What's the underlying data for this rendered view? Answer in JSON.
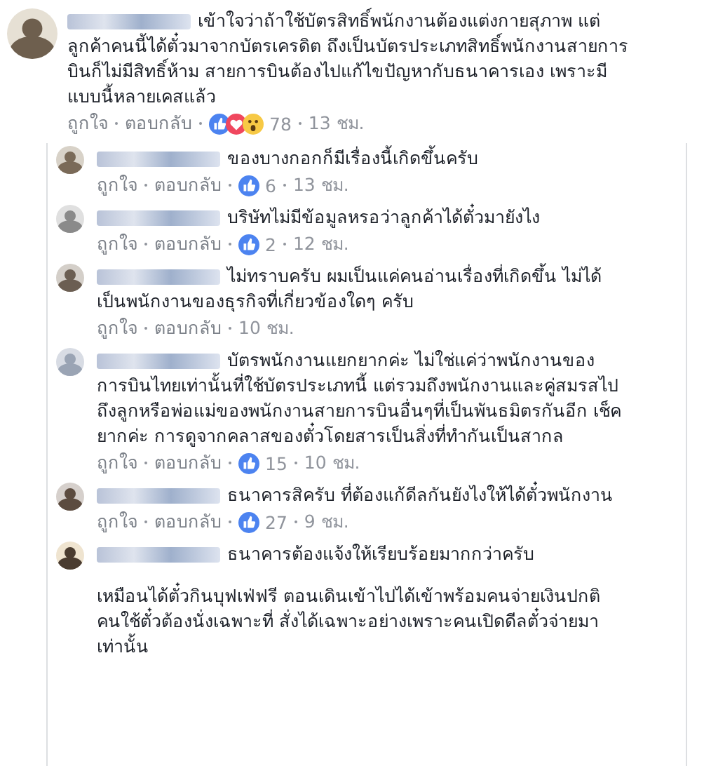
{
  "comment": {
    "text": "เข้าใจว่าถ้าใช้บัตรสิทธิ์พนักงานต้องแต่งกายสุภาพ แต่ลูกค้าคนนี้ได้ตั๋วมาจากบัตรเครดิต ถึงเป็นบัตรประเภทสิทธิ์พนักงานสายการบินก็ไม่มีสิทธิ์ห้าม สายการบินต้องไปแก้ไขปัญหากับธนาคารเอง เพราะมีแบบนี้หลายเคสแล้ว",
    "like": "ถูกใจ",
    "reply": "ตอบกลับ",
    "reactions": [
      {
        "kind": "like"
      },
      {
        "kind": "love"
      },
      {
        "kind": "wow"
      }
    ],
    "count": "78",
    "time": "13 ชม.",
    "replies": [
      {
        "text": "ของบางกอกก็มีเรื่องนี้เกิดขึ้นครับ",
        "like": "ถูกใจ",
        "reply": "ตอบกลับ",
        "reactions": [
          {
            "kind": "like"
          }
        ],
        "count": "6",
        "time": "13 ชม."
      },
      {
        "text": "บริษัทไม่มีข้อมูลหรอว่าลูกค้าได้ตั๋วมายังไง",
        "like": "ถูกใจ",
        "reply": "ตอบกลับ",
        "reactions": [
          {
            "kind": "like"
          }
        ],
        "count": "2",
        "time": "12 ชม."
      },
      {
        "text": "ไม่ทราบครับ ผมเป็นแค่คนอ่านเรื่องที่เกิดขึ้น ไม่ได้เป็นพนักงานของธุรกิจที่เกี่ยวข้องใดๆ ครับ",
        "like": "ถูกใจ",
        "reply": "ตอบกลับ",
        "time": "10 ชม."
      },
      {
        "text": "บัตรพนักงานแยกยากค่ะ ไม่ใช่แค่ว่าพนักงานของการบินไทยเท่านั้นที่ใช้บัตรประเภทนี้ แต่รวมถึงพนักงานและคู่สมรสไปถึงลูกหรือพ่อแม่ของพนักงานสายการบินอื่นๆที่เป็นพันธมิตรกันอีก เช็คยากค่ะ การดูจากคลาสของตั๋วโดยสารเป็นสิ่งที่ทำกันเป็นสากล",
        "like": "ถูกใจ",
        "reply": "ตอบกลับ",
        "reactions": [
          {
            "kind": "like"
          }
        ],
        "count": "15",
        "time": "10 ชม."
      },
      {
        "text": "ธนาคารสิครับ ที่ต้องแก้ดีลกันยังไงให้ได้ตั๋วพนักงาน",
        "like": "ถูกใจ",
        "reply": "ตอบกลับ",
        "reactions": [
          {
            "kind": "like"
          }
        ],
        "count": "27",
        "time": "9 ชม."
      },
      {
        "text": "ธนาคารต้องแจ้งให้เรียบร้อยมากกว่าครับ",
        "extra": "เหมือนได้ตั๋วกินบุฟเฟ่ฟรี ตอนเดินเข้าไปได้เข้าพร้อมคนจ่ายเงินปกติ คนใช้ตั๋วต้องนั่งเฉพาะที่ สั่งได้เฉพาะอย่างเพราะคนเปิดดีลตั๋วจ่ายมาเท่านั้น"
      }
    ]
  }
}
